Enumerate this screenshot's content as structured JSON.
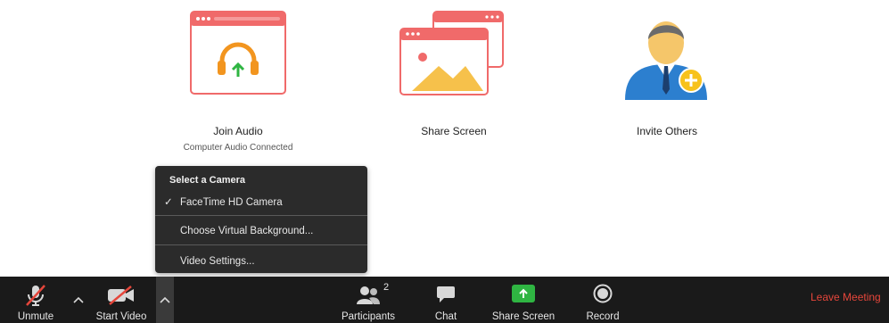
{
  "tiles": {
    "join_audio": {
      "label": "Join Audio",
      "sub": "Computer Audio Connected"
    },
    "share_screen": {
      "label": "Share Screen"
    },
    "invite_others": {
      "label": "Invite Others"
    }
  },
  "camera_menu": {
    "header": "Select a Camera",
    "items": [
      {
        "label": "FaceTime HD Camera",
        "checked": true,
        "check_glyph": "✓"
      },
      {
        "label": "Choose Virtual Background..."
      },
      {
        "label": "Video Settings..."
      }
    ]
  },
  "toolbar": {
    "unmute": "Unmute",
    "start_video": "Start Video",
    "participants": "Participants",
    "participants_count": "2",
    "chat": "Chat",
    "share_screen": "Share Screen",
    "record": "Record",
    "leave": "Leave Meeting"
  },
  "colors": {
    "accent_red": "#e5463b",
    "share_green": "#2fb542",
    "toolbar_bg": "#1a1a1a"
  }
}
